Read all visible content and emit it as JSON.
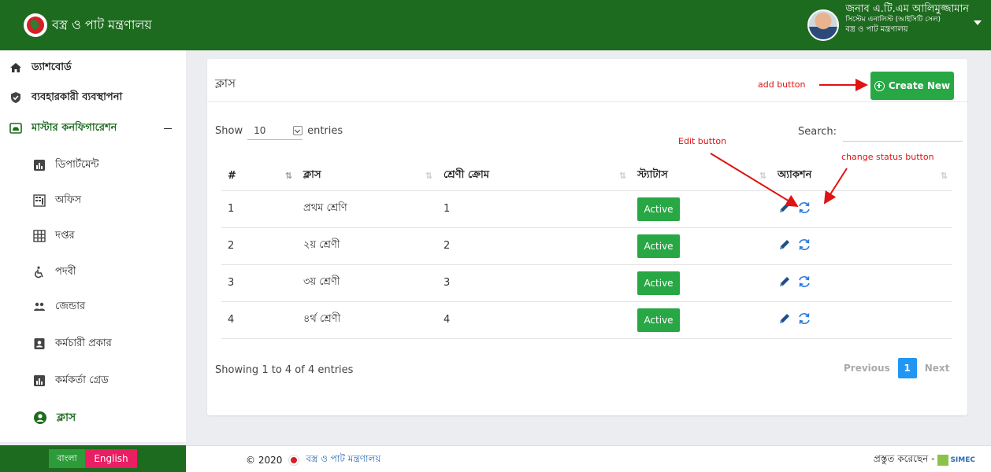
{
  "header": {
    "brand_title": "বস্ত্র ও পাট মন্ত্রণালয়",
    "user_name": "জনাব এ.টি.এম আলিমুজ্জামান",
    "user_role": "সিস্টেম এনালিস্ট (আইসিটি সেল)",
    "user_office": "বস্ত্র ও পাট মন্ত্রণালয়"
  },
  "sidebar": {
    "items": [
      {
        "label": "ড্যাশবোর্ড",
        "icon": "home-icon"
      },
      {
        "label": "ব্যবহারকারী ব্যবস্থাপনা",
        "icon": "shield-check-icon"
      },
      {
        "label": "মাস্টার কনফিগারেশন",
        "icon": "folder-icon"
      },
      {
        "label": "ডিপার্টমেন্ট",
        "icon": "bar-chart-icon"
      },
      {
        "label": "অফিস",
        "icon": "building-icon"
      },
      {
        "label": "দপ্তর",
        "icon": "grid-icon"
      },
      {
        "label": "পদবী",
        "icon": "accessible-icon"
      },
      {
        "label": "জেন্ডার",
        "icon": "people-icon"
      },
      {
        "label": "কর্মচারী প্রকার",
        "icon": "badge-icon"
      },
      {
        "label": "কর্মকর্তা গ্রেড",
        "icon": "bar-chart-icon"
      },
      {
        "label": "ক্লাস",
        "icon": "user-circle-icon"
      }
    ]
  },
  "card": {
    "title": "ক্লাস",
    "create_label": "Create New",
    "show_label": "Show",
    "entries_value": "10",
    "entries_label": "entries",
    "search_label": "Search:",
    "search_value": ""
  },
  "table": {
    "columns": [
      "#",
      "ক্লাস",
      "শ্রেণী ক্রোম",
      "স্ট্যাটাস",
      "অ্যাকশন"
    ],
    "rows": [
      {
        "num": "1",
        "class": "প্রথম শ্রেণি",
        "order": "1",
        "status": "Active"
      },
      {
        "num": "2",
        "class": "২য় শ্রেণী",
        "order": "2",
        "status": "Active"
      },
      {
        "num": "3",
        "class": "৩য় শ্রেণী",
        "order": "3",
        "status": "Active"
      },
      {
        "num": "4",
        "class": "৪র্থ শ্রেণী",
        "order": "4",
        "status": "Active"
      }
    ],
    "info": "Showing 1 to 4 of 4 entries",
    "pagination": {
      "previous": "Previous",
      "current": "1",
      "next": "Next"
    }
  },
  "annotations": {
    "add": "add button",
    "edit": "Edit button",
    "status": "change status button"
  },
  "footer": {
    "lang_bn": "বাংলা",
    "lang_en": "English",
    "copyright": "© 2020",
    "copy_link": "বস্ত্র ও পাট মন্ত্রণালয়",
    "made_by": "প্রস্তুত করেছেন -",
    "vendor": "SIMEC"
  },
  "colors": {
    "brand_green": "#1d6b1f",
    "button_green": "#28a745",
    "accent_blue": "#2196f3",
    "annotation_red": "#e01212",
    "lang_en_pink": "#e91e63"
  }
}
